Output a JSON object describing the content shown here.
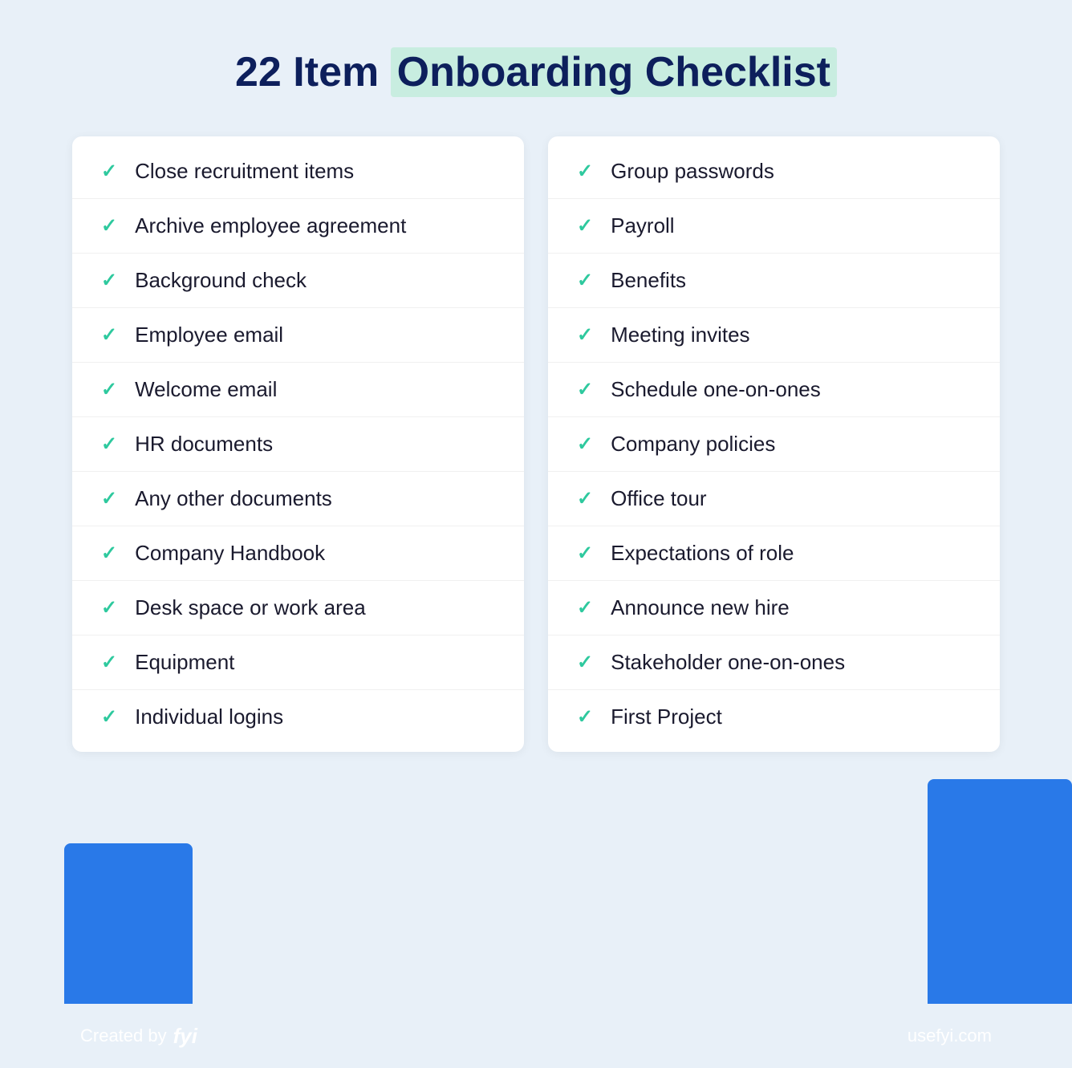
{
  "page": {
    "background": "#e8f0f8",
    "title": {
      "part1": "22 Item ",
      "part2": "Onboarding Checklist"
    }
  },
  "left_column": {
    "items": [
      "Close recruitment items",
      "Archive employee agreement",
      "Background check",
      "Employee email",
      "Welcome email",
      "HR documents",
      "Any other documents",
      "Company Handbook",
      "Desk space or work area",
      "Equipment",
      "Individual logins"
    ]
  },
  "right_column": {
    "items": [
      "Group passwords",
      "Payroll",
      "Benefits",
      "Meeting invites",
      "Schedule one-on-ones",
      "Company policies",
      "Office tour",
      "Expectations of role",
      "Announce new hire",
      "Stakeholder one-on-ones",
      "First Project"
    ]
  },
  "footer": {
    "created_by_label": "Created by",
    "brand": "fyi",
    "url": "usefyi.com"
  },
  "colors": {
    "accent_blue": "#2979e8",
    "accent_green": "#2ec99e",
    "title_dark": "#0d1f5c",
    "highlight_bg": "#c8ede0"
  }
}
